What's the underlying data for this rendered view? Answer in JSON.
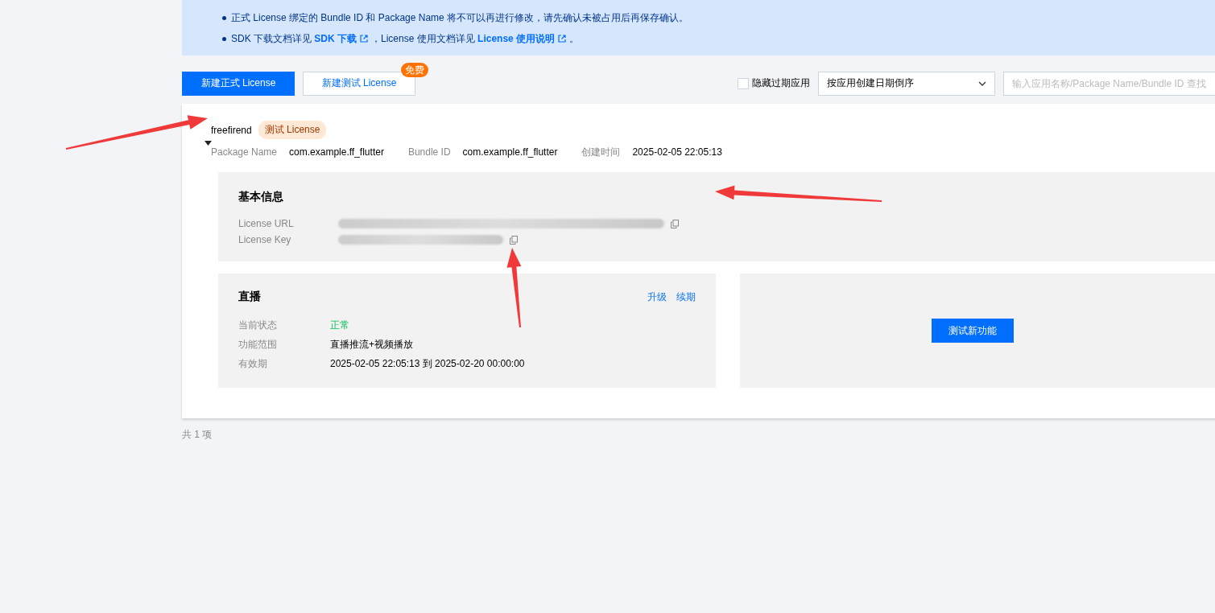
{
  "notice": {
    "items": [
      {
        "kind": "text",
        "text": "正式 License 绑定的 Bundle ID 和 Package Name 将不可以再进行修改，请先确认未被占用后再保存确认。"
      },
      {
        "kind": "links",
        "parts": [
          {
            "text": "SDK 下载文档详见 "
          },
          {
            "link": "SDK 下载"
          },
          {
            "text": "，License 使用文档详见 "
          },
          {
            "link": "License 使用说明"
          },
          {
            "text": "。"
          }
        ]
      }
    ]
  },
  "toolbar": {
    "primary_button": "新建正式 License",
    "secondary_button": "新建测试 License",
    "badge": "免费",
    "hide_expired": {
      "label": "隐藏过期应用",
      "checked": false
    },
    "sort": "按应用创建日期倒序",
    "search": {
      "placeholder": "输入应用名称/Package Name/Bundle ID 查找"
    }
  },
  "app": {
    "name": "freefirend",
    "tag": "测试 License",
    "expanded": true,
    "meta": [
      {
        "label": "Package Name",
        "value": "com.example.ff_flutter"
      },
      {
        "label": "Bundle ID",
        "value": "com.example.ff_flutter"
      },
      {
        "label": "创建时间",
        "value": "2025-02-05 22:05:13"
      }
    ],
    "basic": {
      "title": "基本信息",
      "fields": [
        {
          "label": "License URL"
        },
        {
          "label": "License Key"
        }
      ]
    },
    "live": {
      "title": "直播",
      "actions": [
        "升级",
        "续期"
      ],
      "rows": [
        {
          "label": "当前状态",
          "value": "正常",
          "kind": "status"
        },
        {
          "label": "功能范围",
          "value": "直播推流+视频播放",
          "kind": "text"
        },
        {
          "label": "有效期",
          "value": "2025-02-05 22:05:13 到 2025-02-20 00:00:00",
          "kind": "text"
        }
      ]
    },
    "test_button": "测试新功能"
  },
  "footer": "共 1 项"
}
